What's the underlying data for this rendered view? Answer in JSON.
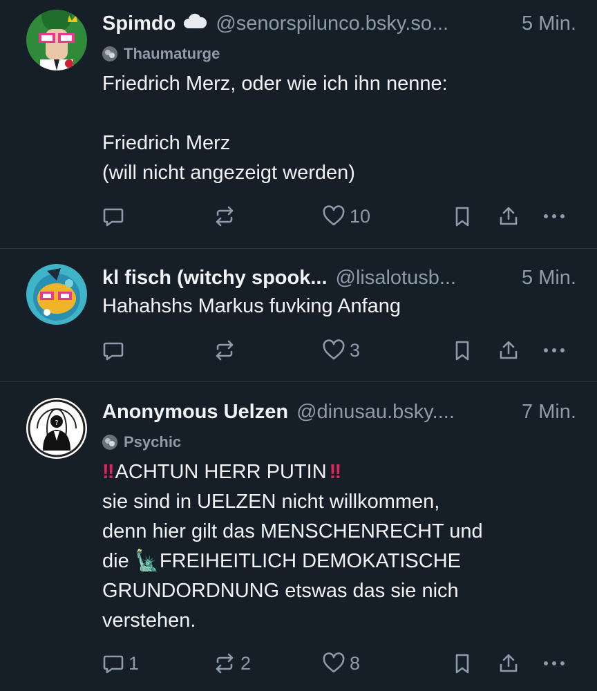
{
  "colors": {
    "background": "#161e27",
    "text": "#f1f3f5",
    "muted": "#8e9baa",
    "divider": "#2e3a48"
  },
  "posts": [
    {
      "display_name": "Spimdo",
      "handle": "@senorspilunco.bsky.so...",
      "time": "5 Min.",
      "label": "Thaumaturge",
      "text": "Friedrich Merz, oder wie ich ihn nenne:\n\nFriedrich Merz\n(will nicht angezeigt werden)",
      "reply_count": "",
      "repost_count": "",
      "like_count": "10"
    },
    {
      "display_name": "kl fisch (witchy spook...",
      "handle": "@lisalotusb...",
      "time": "5 Min.",
      "text": "Hahahshs Markus fuvking Anfang",
      "reply_count": "",
      "repost_count": "",
      "like_count": "3"
    },
    {
      "display_name": "Anonymous Uelzen",
      "handle": "@dinusau.bsky....",
      "time": "7 Min.",
      "label": "Psychic",
      "text_line1": "ACHTUN HERR PUTIN",
      "text_line2": "sie sind in UELZEN nicht willkommen,\ndenn hier gilt das MENSCHENRECHT und\ndie ",
      "text_line3": "FREIHEITLICH DEMOKATISCHE\nGRUNDORDNUNG etswas das sie nich\nverstehen.",
      "emoji_bang": "‼",
      "emoji_statue": "🗽",
      "reply_count": "1",
      "repost_count": "2",
      "like_count": "8"
    }
  ]
}
